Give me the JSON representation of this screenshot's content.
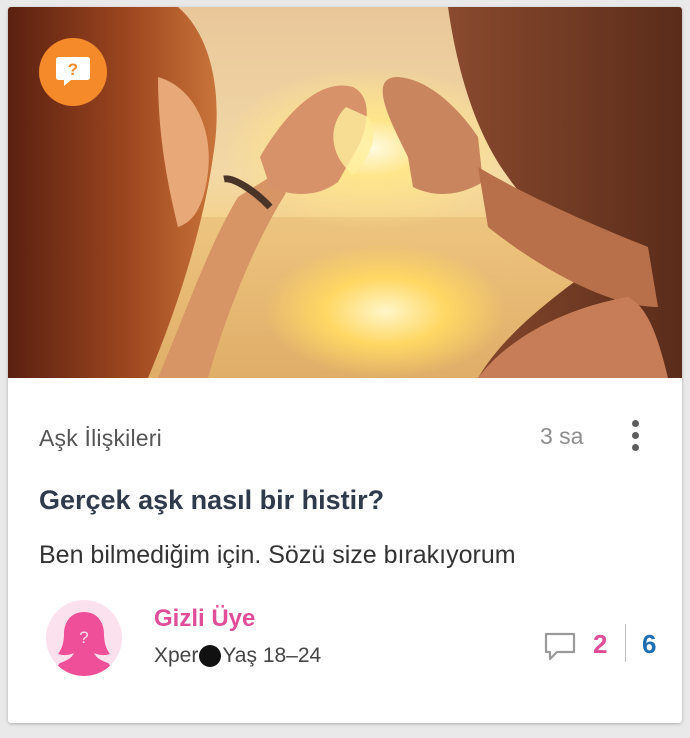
{
  "post": {
    "category": "Aşk İlişkileri",
    "time_ago": "3 sa",
    "title": "Gerçek aşk nasıl bir histir?",
    "description": "Ben bilmediğim için. Sözü size bırakıyorum",
    "badge_icon": "question-bubble-icon",
    "image_alt": "Çift gün batımında elleriyle kalp yapıyor",
    "author": {
      "name": "Gizli Üye",
      "rank": "Xper",
      "age": "Yaş 18–24",
      "avatar_icon": "anonymous-female-avatar"
    },
    "stats": {
      "comment_icon": "comment-icon",
      "comments": "2",
      "second_count": "6"
    }
  },
  "colors": {
    "badge": "#f58a2b",
    "author": "#e04e9a",
    "comments": "#e04e9a",
    "second_count": "#1f6fb3",
    "title": "#2f3a4a"
  }
}
